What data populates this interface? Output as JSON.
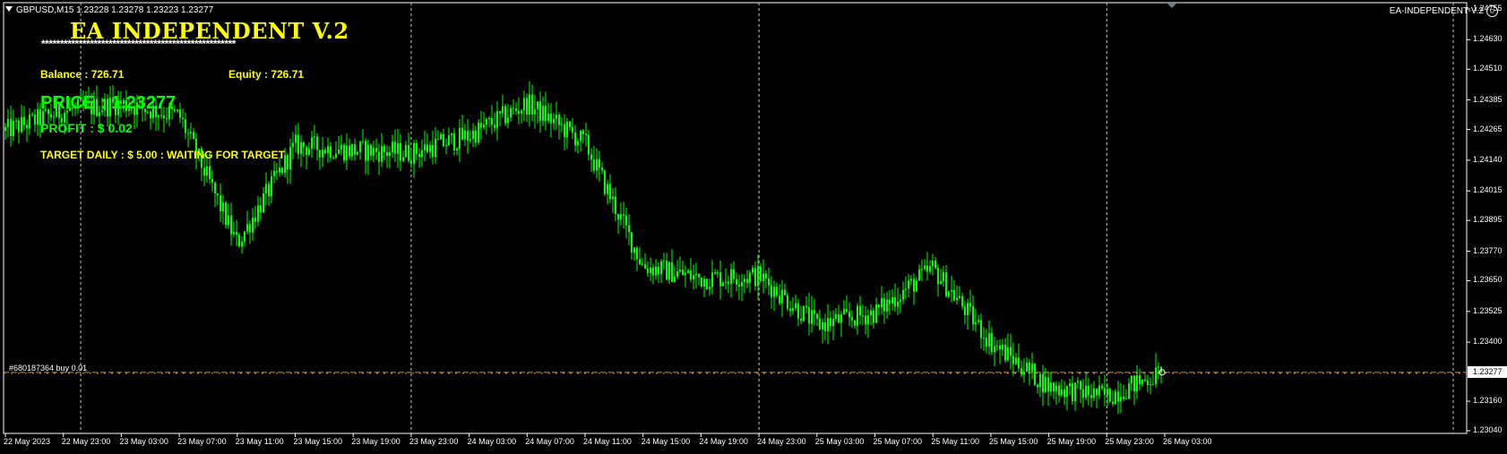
{
  "symbol_info": "GBPUSD,M15  1.23228 1.23278 1.23223 1.23277",
  "ea_indicator_name": "EA-INDEPENDENT-V.2",
  "panel": {
    "title": "EA INDEPENDENT V.2",
    "separator": "****************************************************",
    "balance": "Balance : 726.71",
    "equity": "Equity : 726.71",
    "price": "PRICE : 1.23277",
    "profit": "PROFIT  : $ 0.02",
    "target": "TARGET DAILY : $ 5.00 : WAITING FOR TARGET"
  },
  "order_line_label": "#680187364 buy 0.01",
  "current_price_label": "1.23277",
  "price_axis": [
    "1.24755",
    "1.24630",
    "1.24510",
    "1.24385",
    "1.24265",
    "1.24140",
    "1.24015",
    "1.23895",
    "1.23770",
    "1.23650",
    "1.23525",
    "1.23400",
    "1.23277",
    "1.23160",
    "1.23040"
  ],
  "time_axis": [
    "22 May 2023",
    "22 May 23:00",
    "23 May 03:00",
    "23 May 07:00",
    "23 May 11:00",
    "23 May 15:00",
    "23 May 19:00",
    "23 May 23:00",
    "24 May 03:00",
    "24 May 07:00",
    "24 May 11:00",
    "24 May 15:00",
    "24 May 19:00",
    "24 May 23:00",
    "25 May 03:00",
    "25 May 07:00",
    "25 May 11:00",
    "25 May 15:00",
    "25 May 19:00",
    "25 May 23:00",
    "26 May 03:00"
  ],
  "colors": {
    "background": "#000000",
    "candles": "#00ff00",
    "panel_text": "#ffff00",
    "price_text": "#00ff00",
    "order_line": "#ff8c00",
    "grid": "#c8c8c8"
  },
  "chart_data": {
    "type": "candlestick",
    "symbol": "GBPUSD",
    "timeframe": "M15",
    "ylim": [
      1.2304,
      1.24755
    ],
    "current_price": 1.23277,
    "order_line_price": 1.23277,
    "price_path": [
      [
        "22 May 2023",
        1.2426
      ],
      [
        "22 May 23:00",
        1.2434
      ],
      [
        "23 May 03:00",
        1.2437
      ],
      [
        "23 May 07:00",
        1.2432
      ],
      [
        "23 May 11:00",
        1.238
      ],
      [
        "23 May 15:00",
        1.242
      ],
      [
        "23 May 19:00",
        1.2418
      ],
      [
        "23 May 23:00",
        1.2417
      ],
      [
        "24 May 03:00",
        1.2424
      ],
      [
        "24 May 07:00",
        1.2437
      ],
      [
        "24 May 11:00",
        1.2421
      ],
      [
        "24 May 15:00",
        1.2371
      ],
      [
        "24 May 19:00",
        1.2366
      ],
      [
        "24 May 23:00",
        1.2367
      ],
      [
        "25 May 03:00",
        1.2347
      ],
      [
        "25 May 07:00",
        1.2352
      ],
      [
        "25 May 11:00",
        1.237
      ],
      [
        "25 May 15:00",
        1.234
      ],
      [
        "25 May 19:00",
        1.2322
      ],
      [
        "25 May 23:00",
        1.2318
      ],
      [
        "26 May 03:00",
        1.23277
      ]
    ]
  }
}
